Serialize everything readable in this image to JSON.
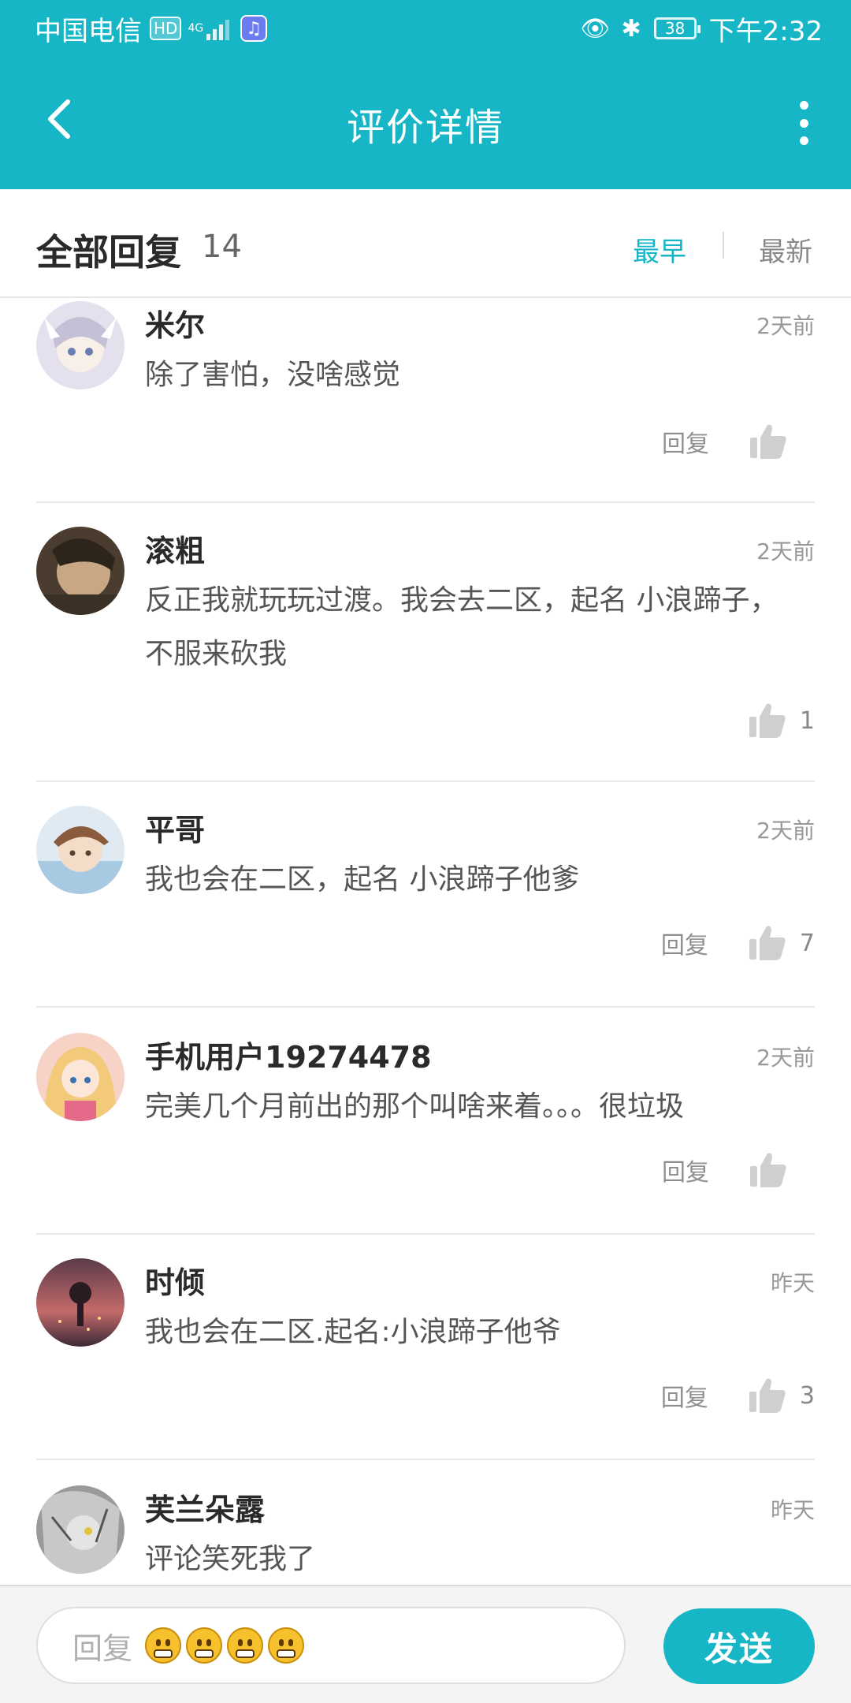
{
  "status_bar": {
    "carrier": "中国电信",
    "hd_badge": "HD",
    "network": "4G",
    "battery": "38",
    "time": "下午2:32"
  },
  "header": {
    "title": "评价详情",
    "back_icon": "chevron-left-icon",
    "more_icon": "more-vertical-icon"
  },
  "replies_header": {
    "title": "全部回复",
    "count": "14",
    "sort_earliest": "最早",
    "sort_newest": "最新",
    "active_sort": "最早"
  },
  "comments": [
    {
      "user": "米尔",
      "time": "2天前",
      "text": "除了害怕，没啥感觉",
      "reply_label": "回复",
      "likes": "",
      "avatar_color": "#c9c5d8"
    },
    {
      "user": "滚粗",
      "time": "2天前",
      "text": "反正我就玩玩过渡。我会去二区，起名  小浪蹄子，不服来砍我",
      "reply_label": "",
      "likes": "1",
      "avatar_color": "#6b5a44"
    },
    {
      "user": "平哥",
      "time": "2天前",
      "text": "我也会在二区，起名  小浪蹄子他爹",
      "reply_label": "回复",
      "likes": "7",
      "avatar_color": "#a9b8c8"
    },
    {
      "user": "手机用户19274478",
      "time": "2天前",
      "text": "完美几个月前出的那个叫啥来着。。。很垃圾",
      "reply_label": "回复",
      "likes": "",
      "avatar_color": "#f0b9a4"
    },
    {
      "user": "时倾",
      "time": "昨天",
      "text": "我也会在二区.起名:小浪蹄子他爷",
      "reply_label": "回复",
      "likes": "3",
      "avatar_color": "#7a4454"
    },
    {
      "user": "芙兰朵露",
      "time": "昨天",
      "text": "评论笑死我了",
      "reply_label": "",
      "likes": "",
      "avatar_color": "#8c8c8c"
    }
  ],
  "bottom_bar": {
    "input_placeholder": "回复",
    "send_label": "发送"
  },
  "colors": {
    "accent": "#17b6c6",
    "like_icon": "#cfcfcf"
  }
}
